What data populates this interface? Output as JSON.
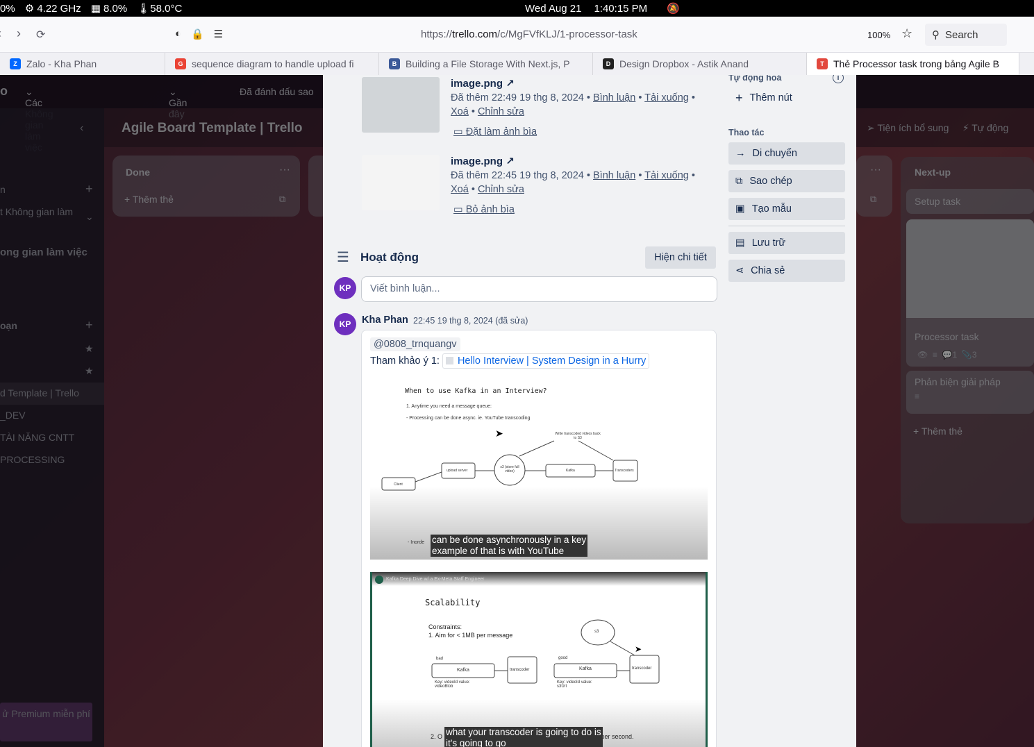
{
  "system_bar": {
    "cpu_percent_left": "0%",
    "cpu_freq": "4.22 GHz",
    "mem": "8.0%",
    "temp": "58.0°C",
    "date": "Wed Aug 21",
    "time": "1:40:15 PM"
  },
  "browser": {
    "url_prefix": "https://",
    "url_domain": "trello.com",
    "url_path": "/c/MgFVfKLJ/1-processor-task",
    "zoom": "100%",
    "search_label": "Search",
    "tabs": [
      {
        "title": "Zalo - Kha Phan",
        "fav_color": "#0068ff",
        "fav_text": "Z"
      },
      {
        "title": "sequence diagram to handle upload fi",
        "fav_color": "#ea4335",
        "fav_text": "G"
      },
      {
        "title": "Building a File Storage With Next.js, P",
        "fav_color": "#3b5998",
        "fav_text": "B"
      },
      {
        "title": "Design Dropbox - Astik Anand",
        "fav_color": "#222222",
        "fav_text": "D"
      },
      {
        "title": "Thẻ Processor task trong bảng Agile B",
        "fav_color": "#e2483d",
        "fav_text": "T"
      }
    ]
  },
  "trello_bg": {
    "nav_items": [
      "o",
      "Các Không gian làm việc",
      "Gần đây",
      "Đã đánh dấu sao"
    ],
    "board_title": "Agile Board Template | Trello",
    "extras": [
      "Tiện ích bổ sung",
      "Tự động"
    ],
    "sidebar_items": [
      "n",
      "t Không gian làm",
      "ong gian làm việc",
      "oạn",
      "d Template | Trello",
      "_DEV",
      "TÀI NĂNG CNTT",
      "PROCESSING",
      "ử Premium miễn phí"
    ],
    "list_done": {
      "title": "Done",
      "add_card": "Thêm thẻ"
    },
    "list_next": {
      "title": "Next-up",
      "cards": [
        "Setup task",
        "Processor task",
        "Phản biện giải pháp"
      ],
      "add_card": "Thêm thẻ",
      "comments": "1",
      "attachments": "3"
    }
  },
  "modal": {
    "attachments": [
      {
        "name": "image.png",
        "added": "Đã thêm 22:49 19 thg 8, 2024",
        "comment": "Bình luận",
        "download": "Tải xuống",
        "delete": "Xoá",
        "edit": "Chỉnh sửa",
        "cover_action": "Đặt làm ảnh bìa",
        "thumb_color": "#d1d5d8"
      },
      {
        "name": "image.png",
        "added": "Đã thêm 22:45 19 thg 8, 2024",
        "comment": "Bình luận",
        "download": "Tải xuống",
        "delete": "Xoá",
        "edit": "Chỉnh sửa",
        "cover_action": "Bỏ ảnh bìa",
        "thumb_color": "#f4f4f4"
      }
    ],
    "activity": {
      "title": "Hoạt động",
      "show_details": "Hiện chi tiết",
      "comment_placeholder": "Viết bình luận...",
      "avatar_initials": "KP"
    },
    "comment": {
      "author": "Kha Phan",
      "time": "22:45 19 thg 8, 2024 (đã sửa)",
      "mention": "@0808_trnquangv",
      "ref_label": "Tham khảo ý 1:",
      "ref_link": "Hello Interview | System Design in a Hurry",
      "image1": {
        "heading": "When to use Kafka in an Interview?",
        "line1": "1. Anytime you need a message queue:",
        "line2": "- Processing can be done async. ie. YouTube transcoding",
        "nodes": [
          "Client",
          "upload server",
          "s3 (store full video)",
          "Kafka",
          "Transcoders"
        ],
        "arrow_note": "Write transcoded videos back to S3",
        "caption_line1": "can be done asynchronously in a key",
        "caption_line2": "example of that is with YouTube",
        "partial": "- Inorde"
      },
      "image2": {
        "header": "Kafka Deep Dive w/ a Ex-Meta Staff Engineer",
        "heading": "Scalability",
        "constraints": "Constraints:",
        "c1": "1. Aim for < 1MB per message",
        "bad": "bad",
        "good": "good",
        "kafka": "Kafka",
        "transcoder": "transcoder",
        "s3": "s3",
        "bad_kv": "Key: videoId value: videoBlob",
        "good_kv": "Key: videoId value: s3Url",
        "caption_line1": "what your transcoder is going to do is",
        "caption_line2": "it's going to go",
        "partial": "2. O",
        "partial2": "messages per second."
      }
    },
    "side": {
      "automation_heading": "Tự động hoá",
      "add_button": "Thêm nút",
      "actions_heading": "Thao tác",
      "actions": [
        {
          "label": "Di chuyển",
          "icon": "→"
        },
        {
          "label": "Sao chép",
          "icon": "⧉"
        },
        {
          "label": "Tạo mẫu",
          "icon": "▣"
        }
      ],
      "archive": "Lưu trữ",
      "share": "Chia sẻ"
    }
  }
}
